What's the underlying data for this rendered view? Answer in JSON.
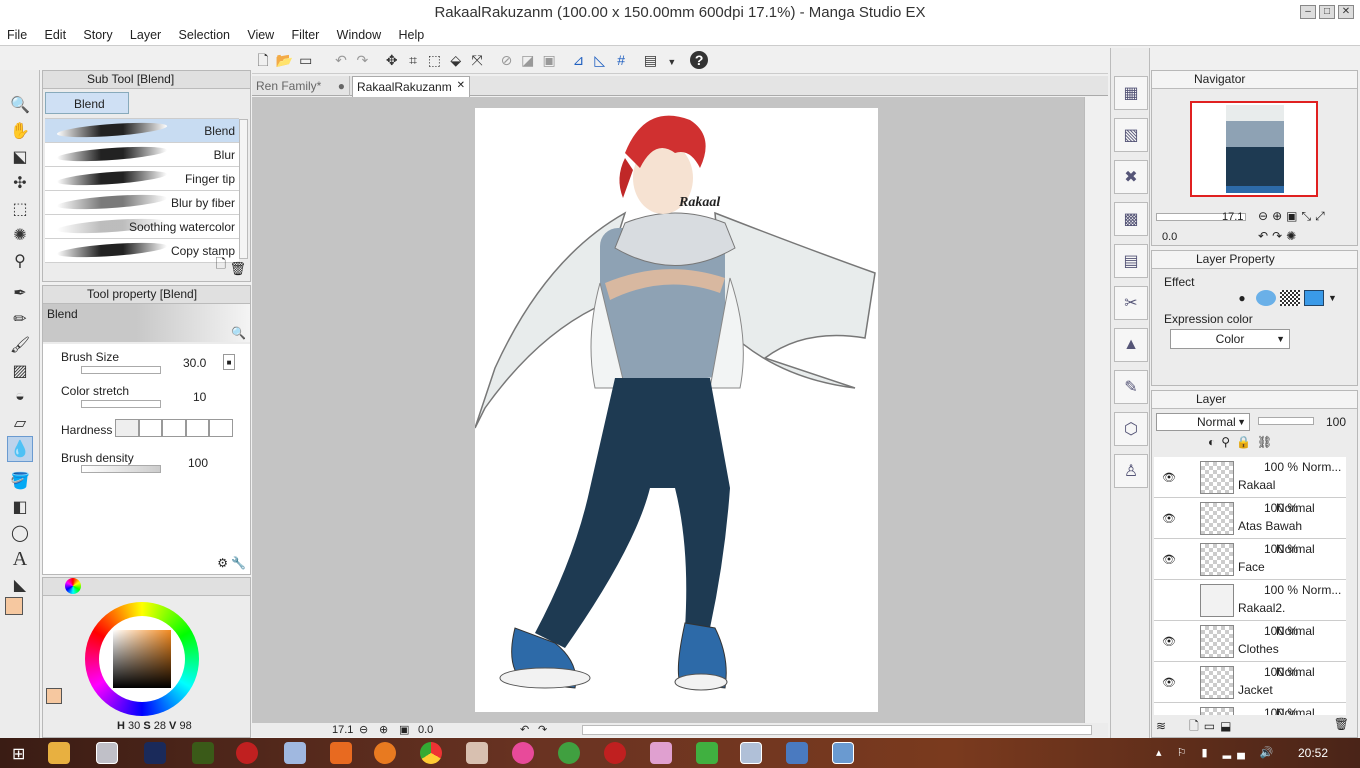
{
  "window": {
    "title": "RakaalRakuzanm (100.00 x 150.00mm 600dpi 17.1%)  - Manga Studio EX"
  },
  "menu": [
    "File",
    "Edit",
    "Story",
    "Layer",
    "Selection",
    "View",
    "Filter",
    "Window",
    "Help"
  ],
  "tabs": [
    {
      "label": "Ren Family*"
    },
    {
      "label": "RakaalRakuzanm"
    }
  ],
  "subtool": {
    "header": "Sub Tool [Blend]",
    "group": "Blend",
    "items": [
      {
        "label": "Blend"
      },
      {
        "label": "Blur"
      },
      {
        "label": "Finger tip"
      },
      {
        "label": "Blur by fiber"
      },
      {
        "label": "Soothing watercolor"
      },
      {
        "label": "Copy stamp"
      }
    ]
  },
  "toolprop": {
    "header": "Tool property [Blend]",
    "preview_label": "Blend",
    "brush_size": {
      "label": "Brush Size",
      "value": "30.0"
    },
    "color_stretch": {
      "label": "Color stretch",
      "value": "10"
    },
    "hardness": {
      "label": "Hardness"
    },
    "brush_density": {
      "label": "Brush density",
      "value": "100"
    }
  },
  "color": {
    "h": "30",
    "s": "28",
    "v": "98",
    "accent": "#f6c8a0"
  },
  "canvas": {
    "signature": "Rakaal",
    "zoom": "17.1",
    "rotation": "0.0"
  },
  "navigator": {
    "header": "Navigator",
    "zoom": "17.1",
    "rotation": "0.0"
  },
  "layer_property": {
    "header": "Layer Property",
    "effect_label": "Effect",
    "expression_label": "Expression color",
    "expression_value": "Color"
  },
  "layers": {
    "header": "Layer",
    "blend_mode": "Normal",
    "opacity": "100",
    "items": [
      {
        "pct": "100 %",
        "mode": "Norm...",
        "name": "Rakaal",
        "visible": true
      },
      {
        "pct": "100 %",
        "mode": "Normal",
        "name": "Atas Bawah",
        "visible": true
      },
      {
        "pct": "100 %",
        "mode": "Normal",
        "name": "Face",
        "visible": true
      },
      {
        "pct": "100 %",
        "mode": "Norm...",
        "name": "Rakaal2.",
        "visible": false
      },
      {
        "pct": "100 %",
        "mode": "Normal",
        "name": "Clothes",
        "visible": true
      },
      {
        "pct": "100 %",
        "mode": "Normal",
        "name": "Jacket",
        "visible": true
      },
      {
        "pct": "100 %",
        "mode": "Normal",
        "name": "",
        "visible": false
      }
    ]
  },
  "taskbar": {
    "time": "20:52"
  }
}
